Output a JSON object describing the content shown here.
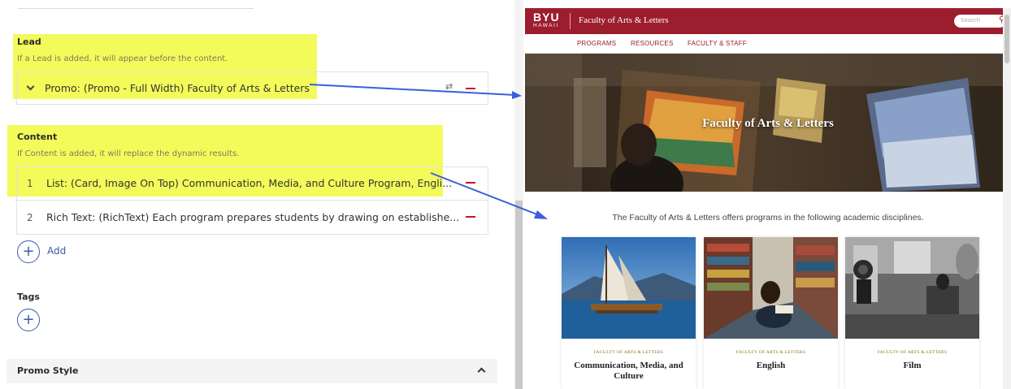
{
  "editor": {
    "lead": {
      "title": "Lead",
      "description": "If a Lead is added, it will appear before the content.",
      "item": "Promo: (Promo - Full Width) Faculty of Arts & Letters"
    },
    "content": {
      "title": "Content",
      "description": "If Content is added, it will replace the dynamic results.",
      "items": [
        {
          "num": "1",
          "label": "List: (Card, Image On Top) Communication, Media, and Culture Program, Engli..."
        },
        {
          "num": "2",
          "label": "Rich Text: (RichText) Each program prepares students by drawing on establishe..."
        }
      ],
      "add_label": "Add"
    },
    "tags": {
      "title": "Tags"
    },
    "promo_style": {
      "label": "Promo Style"
    },
    "highlight_color": "#f0fa3c",
    "arrow_color": "#3b5fd9",
    "remove_color": "#c8102e"
  },
  "preview": {
    "logo_big": "BYU",
    "logo_small": "HAWAII",
    "site_title": "Faculty of Arts & Letters",
    "search_placeholder": "Search",
    "nav": [
      "PROGRAMS",
      "RESOURCES",
      "FACULTY & STAFF"
    ],
    "hero_title": "Faculty of Arts & Letters",
    "intro": "The Faculty of Arts & Letters offers programs in the following academic disciplines.",
    "cards": [
      {
        "eyebrow": "FACULTY OF ARTS & LETTERS",
        "title": "Communication, Media, and Culture"
      },
      {
        "eyebrow": "FACULTY OF ARTS & LETTERS",
        "title": "English"
      },
      {
        "eyebrow": "FACULTY OF ARTS & LETTERS",
        "title": "Film"
      }
    ],
    "brand_color": "#9c1d2e"
  }
}
